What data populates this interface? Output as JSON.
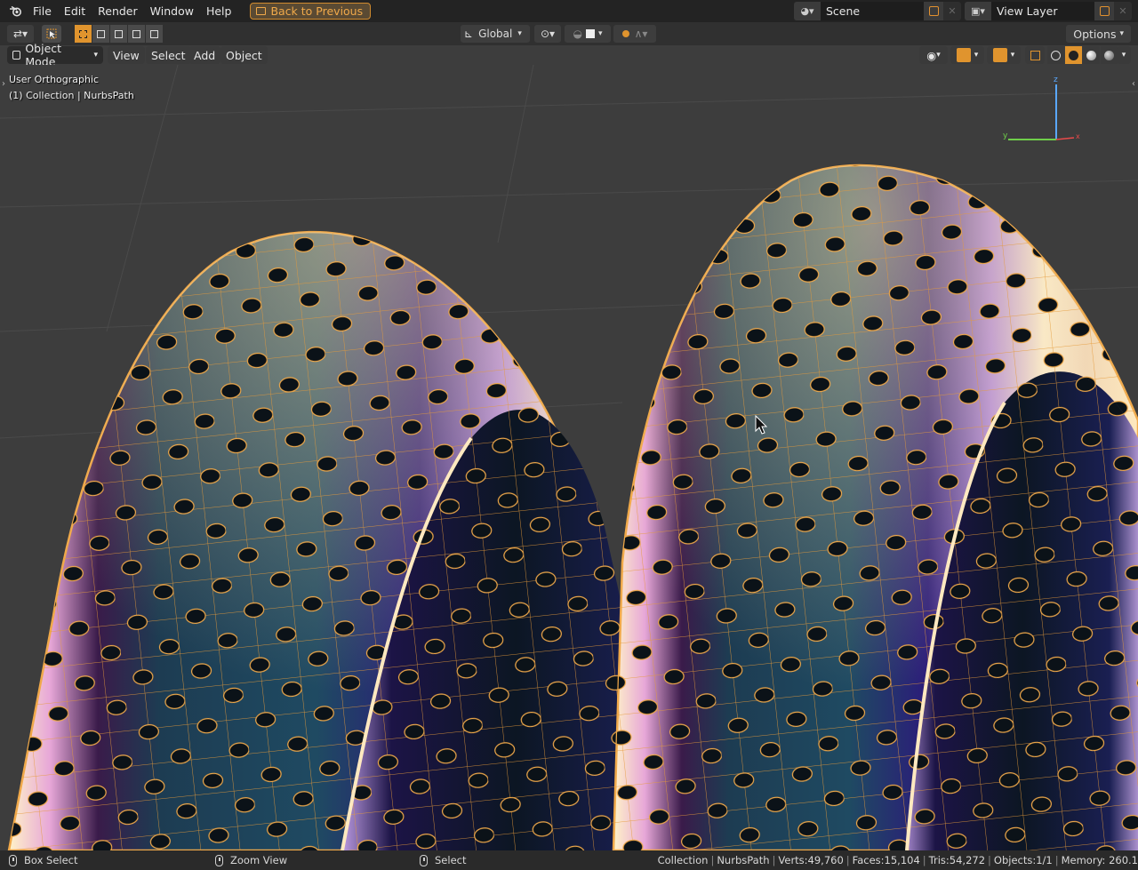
{
  "menubar": {
    "items": [
      "File",
      "Edit",
      "Render",
      "Window",
      "Help"
    ],
    "back_button": "Back to Previous",
    "scene": "Scene",
    "view_layer": "View Layer"
  },
  "toolbar": {
    "orientation": "Global",
    "options_label": "Options"
  },
  "viewport_header": {
    "mode": "Object Mode",
    "menus": [
      "View",
      "Select",
      "Add",
      "Object"
    ]
  },
  "viewport": {
    "view_name": "User Orthographic",
    "collection_info": "(1) Collection | NurbsPath",
    "gizmo_axis_label": "z"
  },
  "statusbar": {
    "box_select": "Box Select",
    "zoom_view": "Zoom View",
    "select": "Select",
    "collection": "Collection",
    "object": "NurbsPath",
    "verts": "Verts:49,760",
    "faces": "Faces:15,104",
    "tris": "Tris:54,272",
    "objects": "Objects:1/1",
    "memory": "Memory: 260.1"
  },
  "colors": {
    "accent": "#e0942e",
    "selection_wire": "#f0a94a",
    "viewport_bg": "#3d3d3d",
    "header_bg": "#232323"
  }
}
